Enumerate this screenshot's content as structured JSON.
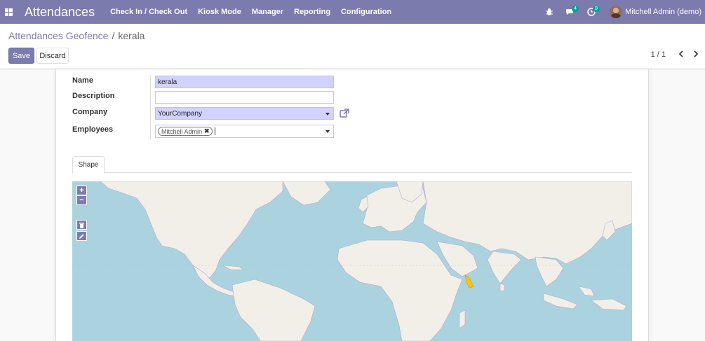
{
  "navbar": {
    "app_name": "Attendances",
    "menu": [
      "Check In / Check Out",
      "Kiosk Mode",
      "Manager",
      "Reporting",
      "Configuration"
    ],
    "messages_count": "4",
    "activities_count": "8",
    "user_name": "Mitchell Admin (demo)",
    "bg_color": "#7c7bad"
  },
  "breadcrumb": {
    "parent": "Attendances Geofence",
    "separator": "/",
    "current": "kerala"
  },
  "buttons": {
    "save": "Save",
    "discard": "Discard"
  },
  "pager": {
    "value": "1 / 1"
  },
  "form": {
    "name_label": "Name",
    "name_value": "kerala",
    "description_label": "Description",
    "description_value": "",
    "company_label": "Company",
    "company_value": "YourCompany",
    "employees_label": "Employees",
    "employee_tag": "Mitchell Admin"
  },
  "tabs": {
    "shape": "Shape"
  },
  "map": {
    "zoom_in": "+",
    "zoom_out": "−",
    "tools": [
      "trash-icon",
      "pencil-icon"
    ],
    "water_color": "#aad3df",
    "land_color": "#f2efe9",
    "geofence_color": "#f5c518"
  }
}
